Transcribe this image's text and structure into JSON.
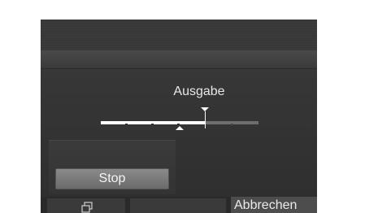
{
  "slider": {
    "label": "Ausgabe",
    "value_fraction": 0.66,
    "reference_fraction": 0.5
  },
  "panel": {
    "stop_label": "Stop"
  },
  "nav": {
    "cancel_label": "Abbrechen",
    "left_icon": "copy-icon"
  }
}
